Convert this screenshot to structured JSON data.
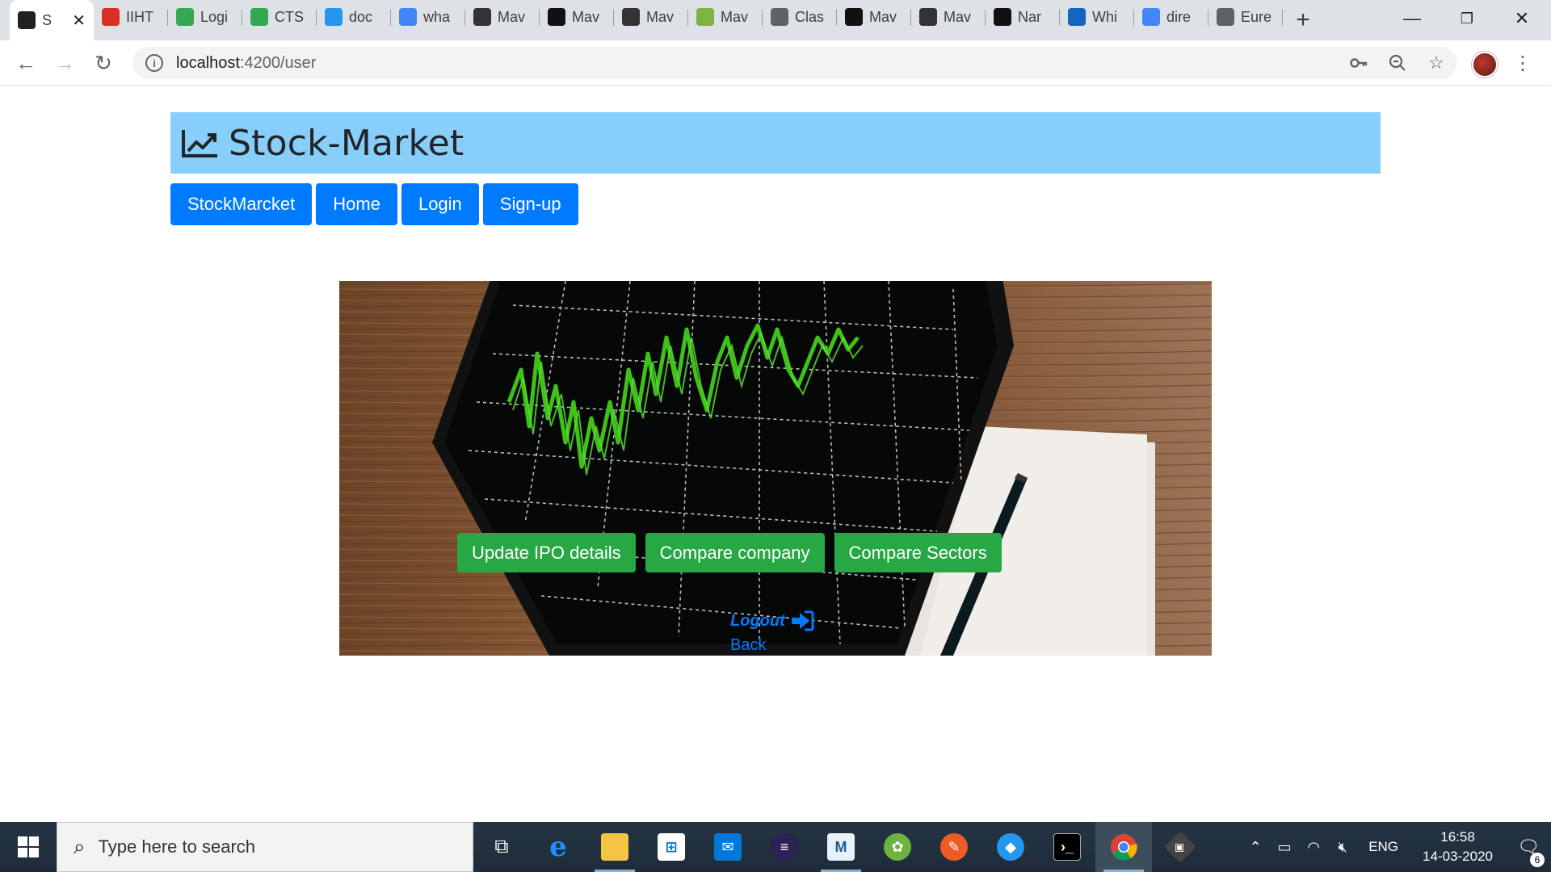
{
  "browser": {
    "tabs": [
      {
        "title": "S",
        "icon": "angular-icon",
        "color": "#202124",
        "active": true
      },
      {
        "title": "IIHT",
        "icon": "gmail-icon",
        "color": "#d93025"
      },
      {
        "title": "Logi",
        "icon": "check-icon",
        "color": "#34a853"
      },
      {
        "title": "CTS",
        "icon": "check-icon",
        "color": "#34a853"
      },
      {
        "title": "doc",
        "icon": "docker-icon",
        "color": "#2496ed"
      },
      {
        "title": "wha",
        "icon": "google-icon",
        "color": "#4285f4"
      },
      {
        "title": "Mav",
        "icon": "diamond-icon",
        "color": "#333333"
      },
      {
        "title": "Mav",
        "icon": "sf-icon",
        "color": "#111111"
      },
      {
        "title": "Mav",
        "icon": "diamond-icon",
        "color": "#333333"
      },
      {
        "title": "Mav",
        "icon": "leaf-icon",
        "color": "#7cb342"
      },
      {
        "title": "Clas",
        "icon": "globe-icon",
        "color": "#5f6368"
      },
      {
        "title": "Mav",
        "icon": "sf-icon",
        "color": "#111111"
      },
      {
        "title": "Mav",
        "icon": "diamond-icon",
        "color": "#333333"
      },
      {
        "title": "Nar",
        "icon": "github-icon",
        "color": "#111111"
      },
      {
        "title": "Whi",
        "icon": "wave-icon",
        "color": "#1565c0"
      },
      {
        "title": "dire",
        "icon": "google-icon",
        "color": "#4285f4"
      },
      {
        "title": "Eure",
        "icon": "globe-icon",
        "color": "#5f6368"
      }
    ],
    "close_glyph": "✕",
    "new_tab": "+",
    "url_host": "localhost",
    "url_path": ":4200/user"
  },
  "app": {
    "title": "Stock-Market",
    "nav": [
      "StockMarcket",
      "Home",
      "Login",
      "Sign-up"
    ],
    "actions": [
      "Update IPO details",
      "Compare company",
      "Compare Sectors"
    ],
    "logout": "Logout",
    "back": "Back"
  },
  "taskbar": {
    "search_placeholder": "Type here to search",
    "language": "ENG",
    "time": "16:58",
    "date": "14-03-2020",
    "notification_count": "6"
  },
  "colors": {
    "header_bg": "#87cefa",
    "primary": "#007bff",
    "success": "#28a745"
  }
}
